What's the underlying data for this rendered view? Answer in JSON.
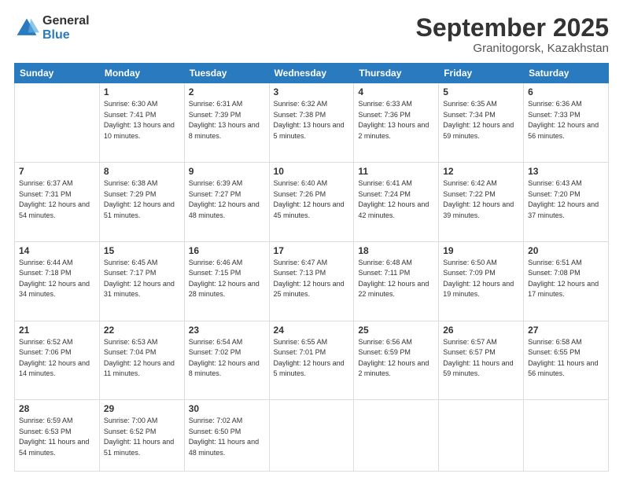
{
  "logo": {
    "general": "General",
    "blue": "Blue"
  },
  "header": {
    "month": "September 2025",
    "location": "Granitogorsk, Kazakhstan"
  },
  "days_of_week": [
    "Sunday",
    "Monday",
    "Tuesday",
    "Wednesday",
    "Thursday",
    "Friday",
    "Saturday"
  ],
  "weeks": [
    [
      {
        "day": "",
        "sunrise": "",
        "sunset": "",
        "daylight": ""
      },
      {
        "day": "1",
        "sunrise": "Sunrise: 6:30 AM",
        "sunset": "Sunset: 7:41 PM",
        "daylight": "Daylight: 13 hours and 10 minutes."
      },
      {
        "day": "2",
        "sunrise": "Sunrise: 6:31 AM",
        "sunset": "Sunset: 7:39 PM",
        "daylight": "Daylight: 13 hours and 8 minutes."
      },
      {
        "day": "3",
        "sunrise": "Sunrise: 6:32 AM",
        "sunset": "Sunset: 7:38 PM",
        "daylight": "Daylight: 13 hours and 5 minutes."
      },
      {
        "day": "4",
        "sunrise": "Sunrise: 6:33 AM",
        "sunset": "Sunset: 7:36 PM",
        "daylight": "Daylight: 13 hours and 2 minutes."
      },
      {
        "day": "5",
        "sunrise": "Sunrise: 6:35 AM",
        "sunset": "Sunset: 7:34 PM",
        "daylight": "Daylight: 12 hours and 59 minutes."
      },
      {
        "day": "6",
        "sunrise": "Sunrise: 6:36 AM",
        "sunset": "Sunset: 7:33 PM",
        "daylight": "Daylight: 12 hours and 56 minutes."
      }
    ],
    [
      {
        "day": "7",
        "sunrise": "Sunrise: 6:37 AM",
        "sunset": "Sunset: 7:31 PM",
        "daylight": "Daylight: 12 hours and 54 minutes."
      },
      {
        "day": "8",
        "sunrise": "Sunrise: 6:38 AM",
        "sunset": "Sunset: 7:29 PM",
        "daylight": "Daylight: 12 hours and 51 minutes."
      },
      {
        "day": "9",
        "sunrise": "Sunrise: 6:39 AM",
        "sunset": "Sunset: 7:27 PM",
        "daylight": "Daylight: 12 hours and 48 minutes."
      },
      {
        "day": "10",
        "sunrise": "Sunrise: 6:40 AM",
        "sunset": "Sunset: 7:26 PM",
        "daylight": "Daylight: 12 hours and 45 minutes."
      },
      {
        "day": "11",
        "sunrise": "Sunrise: 6:41 AM",
        "sunset": "Sunset: 7:24 PM",
        "daylight": "Daylight: 12 hours and 42 minutes."
      },
      {
        "day": "12",
        "sunrise": "Sunrise: 6:42 AM",
        "sunset": "Sunset: 7:22 PM",
        "daylight": "Daylight: 12 hours and 39 minutes."
      },
      {
        "day": "13",
        "sunrise": "Sunrise: 6:43 AM",
        "sunset": "Sunset: 7:20 PM",
        "daylight": "Daylight: 12 hours and 37 minutes."
      }
    ],
    [
      {
        "day": "14",
        "sunrise": "Sunrise: 6:44 AM",
        "sunset": "Sunset: 7:18 PM",
        "daylight": "Daylight: 12 hours and 34 minutes."
      },
      {
        "day": "15",
        "sunrise": "Sunrise: 6:45 AM",
        "sunset": "Sunset: 7:17 PM",
        "daylight": "Daylight: 12 hours and 31 minutes."
      },
      {
        "day": "16",
        "sunrise": "Sunrise: 6:46 AM",
        "sunset": "Sunset: 7:15 PM",
        "daylight": "Daylight: 12 hours and 28 minutes."
      },
      {
        "day": "17",
        "sunrise": "Sunrise: 6:47 AM",
        "sunset": "Sunset: 7:13 PM",
        "daylight": "Daylight: 12 hours and 25 minutes."
      },
      {
        "day": "18",
        "sunrise": "Sunrise: 6:48 AM",
        "sunset": "Sunset: 7:11 PM",
        "daylight": "Daylight: 12 hours and 22 minutes."
      },
      {
        "day": "19",
        "sunrise": "Sunrise: 6:50 AM",
        "sunset": "Sunset: 7:09 PM",
        "daylight": "Daylight: 12 hours and 19 minutes."
      },
      {
        "day": "20",
        "sunrise": "Sunrise: 6:51 AM",
        "sunset": "Sunset: 7:08 PM",
        "daylight": "Daylight: 12 hours and 17 minutes."
      }
    ],
    [
      {
        "day": "21",
        "sunrise": "Sunrise: 6:52 AM",
        "sunset": "Sunset: 7:06 PM",
        "daylight": "Daylight: 12 hours and 14 minutes."
      },
      {
        "day": "22",
        "sunrise": "Sunrise: 6:53 AM",
        "sunset": "Sunset: 7:04 PM",
        "daylight": "Daylight: 12 hours and 11 minutes."
      },
      {
        "day": "23",
        "sunrise": "Sunrise: 6:54 AM",
        "sunset": "Sunset: 7:02 PM",
        "daylight": "Daylight: 12 hours and 8 minutes."
      },
      {
        "day": "24",
        "sunrise": "Sunrise: 6:55 AM",
        "sunset": "Sunset: 7:01 PM",
        "daylight": "Daylight: 12 hours and 5 minutes."
      },
      {
        "day": "25",
        "sunrise": "Sunrise: 6:56 AM",
        "sunset": "Sunset: 6:59 PM",
        "daylight": "Daylight: 12 hours and 2 minutes."
      },
      {
        "day": "26",
        "sunrise": "Sunrise: 6:57 AM",
        "sunset": "Sunset: 6:57 PM",
        "daylight": "Daylight: 11 hours and 59 minutes."
      },
      {
        "day": "27",
        "sunrise": "Sunrise: 6:58 AM",
        "sunset": "Sunset: 6:55 PM",
        "daylight": "Daylight: 11 hours and 56 minutes."
      }
    ],
    [
      {
        "day": "28",
        "sunrise": "Sunrise: 6:59 AM",
        "sunset": "Sunset: 6:53 PM",
        "daylight": "Daylight: 11 hours and 54 minutes."
      },
      {
        "day": "29",
        "sunrise": "Sunrise: 7:00 AM",
        "sunset": "Sunset: 6:52 PM",
        "daylight": "Daylight: 11 hours and 51 minutes."
      },
      {
        "day": "30",
        "sunrise": "Sunrise: 7:02 AM",
        "sunset": "Sunset: 6:50 PM",
        "daylight": "Daylight: 11 hours and 48 minutes."
      },
      {
        "day": "",
        "sunrise": "",
        "sunset": "",
        "daylight": ""
      },
      {
        "day": "",
        "sunrise": "",
        "sunset": "",
        "daylight": ""
      },
      {
        "day": "",
        "sunrise": "",
        "sunset": "",
        "daylight": ""
      },
      {
        "day": "",
        "sunrise": "",
        "sunset": "",
        "daylight": ""
      }
    ]
  ]
}
